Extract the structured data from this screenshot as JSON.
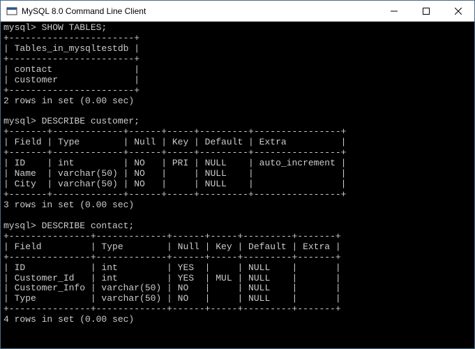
{
  "window": {
    "title": "MySQL 8.0 Command Line Client",
    "icon_label": "mysql-icon"
  },
  "controls": {
    "minimize": "minimize",
    "maximize": "maximize",
    "close": "close"
  },
  "terminal": {
    "prompt": "mysql>",
    "commands": {
      "show_tables": "SHOW TABLES;",
      "describe_customer": "DESCRIBE customer;",
      "describe_contact": "DESCRIBE contact;"
    },
    "show_tables_result": {
      "header": "Tables_in_mysqltestdb",
      "rows": [
        "contact",
        "customer"
      ],
      "footer": "2 rows in set (0.00 sec)"
    },
    "describe_customer_result": {
      "columns": [
        "Field",
        "Type",
        "Null",
        "Key",
        "Default",
        "Extra"
      ],
      "rows": [
        {
          "Field": "ID",
          "Type": "int",
          "Null": "NO",
          "Key": "PRI",
          "Default": "NULL",
          "Extra": "auto_increment"
        },
        {
          "Field": "Name",
          "Type": "varchar(50)",
          "Null": "NO",
          "Key": "",
          "Default": "NULL",
          "Extra": ""
        },
        {
          "Field": "City",
          "Type": "varchar(50)",
          "Null": "NO",
          "Key": "",
          "Default": "NULL",
          "Extra": ""
        }
      ],
      "footer": "3 rows in set (0.00 sec)"
    },
    "describe_contact_result": {
      "columns": [
        "Field",
        "Type",
        "Null",
        "Key",
        "Default",
        "Extra"
      ],
      "rows": [
        {
          "Field": "ID",
          "Type": "int",
          "Null": "YES",
          "Key": "",
          "Default": "NULL",
          "Extra": ""
        },
        {
          "Field": "Customer_Id",
          "Type": "int",
          "Null": "YES",
          "Key": "MUL",
          "Default": "NULL",
          "Extra": ""
        },
        {
          "Field": "Customer_Info",
          "Type": "varchar(50)",
          "Null": "NO",
          "Key": "",
          "Default": "NULL",
          "Extra": ""
        },
        {
          "Field": "Type",
          "Type": "varchar(50)",
          "Null": "NO",
          "Key": "",
          "Default": "NULL",
          "Extra": ""
        }
      ],
      "footer": "4 rows in set (0.00 sec)"
    }
  }
}
